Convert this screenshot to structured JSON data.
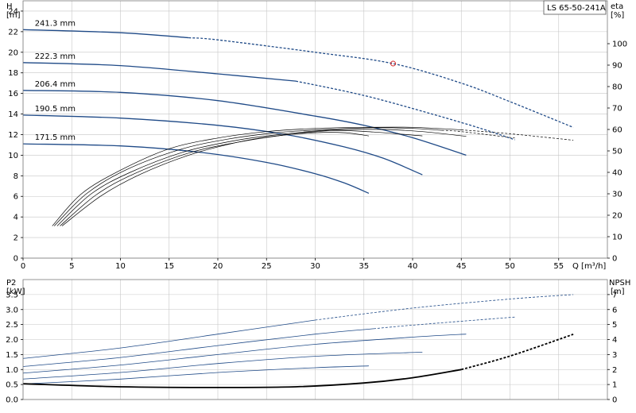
{
  "model_label": "LS 65-50-241A",
  "colors": {
    "head": "#1f4a87",
    "eff": "#000000",
    "npsh": "#000000",
    "grid": "#c6c6c6",
    "marker": "#d62828"
  },
  "chart_data": [
    {
      "type": "line",
      "panel": "head-efficiency",
      "ylabel": "H",
      "yunit": "[m]",
      "y2label": "eta",
      "y2unit": "[%]",
      "xlabel": "Q [m³/h]",
      "xlim": [
        0,
        60
      ],
      "ylim": [
        0,
        25
      ],
      "y2lim": [
        0,
        120
      ],
      "xticks": [
        0,
        5,
        10,
        15,
        20,
        25,
        30,
        35,
        40,
        45,
        50,
        55
      ],
      "yticks": [
        0,
        2,
        4,
        6,
        8,
        10,
        12,
        14,
        16,
        18,
        20,
        22,
        24
      ],
      "y2ticks": [
        0,
        10,
        20,
        30,
        40,
        50,
        60,
        70,
        80,
        90,
        100
      ],
      "grid": true,
      "series": [
        {
          "name": "241.3 mm",
          "label": "241.3 mm",
          "axis": "H",
          "dashed_from": 17,
          "points": [
            [
              0,
              22.2
            ],
            [
              10,
              21.9
            ],
            [
              20,
              21.2
            ],
            [
              30,
              20.0
            ],
            [
              38,
              18.9
            ],
            [
              45,
              17.0
            ],
            [
              50,
              15.2
            ],
            [
              56.5,
              12.7
            ]
          ]
        },
        {
          "name": "222.3 mm",
          "label": "222.3 mm",
          "axis": "H",
          "dashed_from": 28,
          "points": [
            [
              0,
              19.0
            ],
            [
              10,
              18.7
            ],
            [
              20,
              17.9
            ],
            [
              28,
              17.2
            ],
            [
              35,
              15.8
            ],
            [
              42,
              14.0
            ],
            [
              47,
              12.6
            ],
            [
              50.5,
              11.5
            ]
          ]
        },
        {
          "name": "206.4 mm",
          "label": "206.4 mm",
          "axis": "H",
          "points": [
            [
              0,
              16.3
            ],
            [
              10,
              16.1
            ],
            [
              20,
              15.3
            ],
            [
              30,
              13.8
            ],
            [
              35,
              12.9
            ],
            [
              40,
              11.7
            ],
            [
              45.5,
              10.0
            ]
          ]
        },
        {
          "name": "190.5 mm",
          "label": "190.5 mm",
          "axis": "H",
          "points": [
            [
              0,
              13.9
            ],
            [
              10,
              13.6
            ],
            [
              20,
              12.9
            ],
            [
              27,
              12.0
            ],
            [
              33,
              10.8
            ],
            [
              37,
              9.7
            ],
            [
              41,
              8.1
            ]
          ]
        },
        {
          "name": "171.5 mm",
          "label": "171.5 mm",
          "axis": "H",
          "points": [
            [
              0,
              11.1
            ],
            [
              10,
              10.9
            ],
            [
              18,
              10.3
            ],
            [
              25,
              9.3
            ],
            [
              30,
              8.2
            ],
            [
              33,
              7.3
            ],
            [
              35.5,
              6.3
            ]
          ]
        },
        {
          "axis": "eta",
          "dashed_from": 45,
          "points": [
            [
              3,
              15
            ],
            [
              6,
              30
            ],
            [
              10,
              41
            ],
            [
              15,
              51
            ],
            [
              20,
              56
            ],
            [
              25,
              59
            ],
            [
              30,
              60.5
            ],
            [
              35,
              61
            ],
            [
              40,
              61
            ],
            [
              45,
              59.8
            ],
            [
              50,
              58
            ],
            [
              56.5,
              55
            ]
          ]
        },
        {
          "axis": "eta",
          "dashed_from": 43,
          "points": [
            [
              3.2,
              15
            ],
            [
              6.5,
              30
            ],
            [
              10.5,
              41
            ],
            [
              16,
              50.5
            ],
            [
              21,
              55.5
            ],
            [
              26,
              58.5
            ],
            [
              31,
              60
            ],
            [
              36,
              60.8
            ],
            [
              40,
              60.5
            ],
            [
              45,
              59
            ],
            [
              50.5,
              56
            ]
          ]
        },
        {
          "axis": "eta",
          "points": [
            [
              3.5,
              15
            ],
            [
              7,
              30
            ],
            [
              11,
              40
            ],
            [
              16.5,
              49.5
            ],
            [
              22,
              55
            ],
            [
              27,
              58
            ],
            [
              32,
              59.8
            ],
            [
              37,
              60
            ],
            [
              41,
              59
            ],
            [
              45.5,
              56.8
            ]
          ]
        },
        {
          "axis": "eta",
          "points": [
            [
              3.8,
              15
            ],
            [
              7.5,
              29.5
            ],
            [
              11.5,
              39.5
            ],
            [
              17,
              49
            ],
            [
              22,
              54
            ],
            [
              27,
              57.5
            ],
            [
              32,
              59.5
            ],
            [
              36,
              58.8
            ],
            [
              41,
              57
            ]
          ]
        },
        {
          "axis": "eta",
          "points": [
            [
              4,
              15
            ],
            [
              8,
              29
            ],
            [
              12,
              39
            ],
            [
              17,
              48
            ],
            [
              22,
              54
            ],
            [
              26,
              57
            ],
            [
              30,
              58.5
            ],
            [
              33,
              58.5
            ],
            [
              35.5,
              57
            ]
          ]
        }
      ],
      "marker": {
        "x": 38,
        "y": 18.9
      }
    },
    {
      "type": "line",
      "panel": "power-npsh",
      "ylabel": "P2",
      "yunit": "[kW]",
      "y2label": "NPSH",
      "y2unit": "[m]",
      "xlim": [
        0,
        60
      ],
      "ylim": [
        0,
        4
      ],
      "y2lim": [
        0,
        8
      ],
      "yticks": [
        0,
        0.5,
        1.0,
        1.5,
        2.0,
        2.5,
        3.0,
        3.5
      ],
      "y2ticks": [
        0,
        1,
        2,
        3,
        4,
        5,
        6,
        7
      ],
      "grid": true,
      "series": [
        {
          "axis": "P2",
          "dashed_from": 30,
          "points": [
            [
              0,
              1.37
            ],
            [
              10,
              1.72
            ],
            [
              20,
              2.18
            ],
            [
              30,
              2.65
            ],
            [
              40,
              3.05
            ],
            [
              50,
              3.35
            ],
            [
              56.5,
              3.5
            ]
          ]
        },
        {
          "axis": "P2",
          "dashed_from": 36,
          "points": [
            [
              0,
              1.1
            ],
            [
              10,
              1.4
            ],
            [
              20,
              1.8
            ],
            [
              30,
              2.18
            ],
            [
              40,
              2.48
            ],
            [
              50.5,
              2.75
            ]
          ]
        },
        {
          "axis": "P2",
          "points": [
            [
              0,
              0.88
            ],
            [
              10,
              1.15
            ],
            [
              20,
              1.5
            ],
            [
              30,
              1.84
            ],
            [
              40,
              2.08
            ],
            [
              45.5,
              2.18
            ]
          ]
        },
        {
          "axis": "P2",
          "points": [
            [
              0,
              0.68
            ],
            [
              10,
              0.9
            ],
            [
              20,
              1.2
            ],
            [
              30,
              1.44
            ],
            [
              41,
              1.58
            ]
          ]
        },
        {
          "axis": "P2",
          "points": [
            [
              0,
              0.52
            ],
            [
              10,
              0.68
            ],
            [
              20,
              0.9
            ],
            [
              30,
              1.06
            ],
            [
              35.5,
              1.12
            ]
          ]
        },
        {
          "axis": "NPSH",
          "dashed_from": 45,
          "points": [
            [
              0,
              1.05
            ],
            [
              10,
              0.85
            ],
            [
              20,
              0.8
            ],
            [
              28,
              0.85
            ],
            [
              35,
              1.1
            ],
            [
              40,
              1.45
            ],
            [
              45,
              2.0
            ],
            [
              50,
              2.9
            ],
            [
              56.5,
              4.35
            ]
          ]
        }
      ]
    }
  ]
}
